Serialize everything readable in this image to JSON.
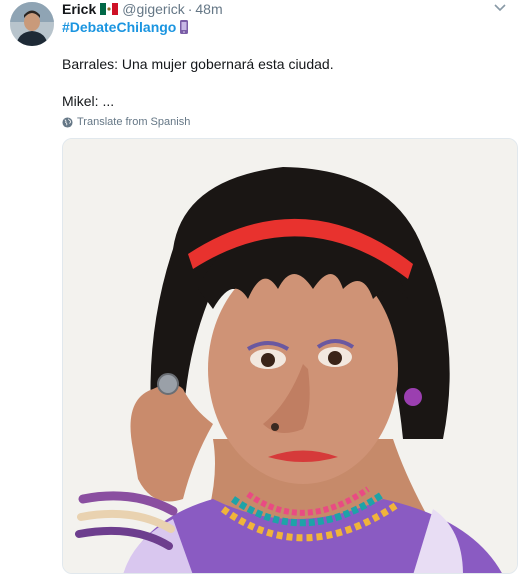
{
  "tweet": {
    "author_name": "Erick",
    "handle": "@gigerick",
    "separator": "·",
    "time": "48m",
    "hashtag": "#DebateChilango",
    "body_line1": "Barrales: Una mujer gobernará esta ciudad.",
    "body_line2": "Mikel: ...",
    "translate_label": "Translate from Spanish"
  },
  "icons": {
    "flag": "mexico-flag-icon",
    "emoji": "mobile-phone-icon",
    "caret": "chevron-down-icon",
    "globe": "globe-icon"
  },
  "colors": {
    "link": "#1b95e0",
    "muted": "#657786",
    "text": "#14171a",
    "headband": "#e8322e"
  }
}
